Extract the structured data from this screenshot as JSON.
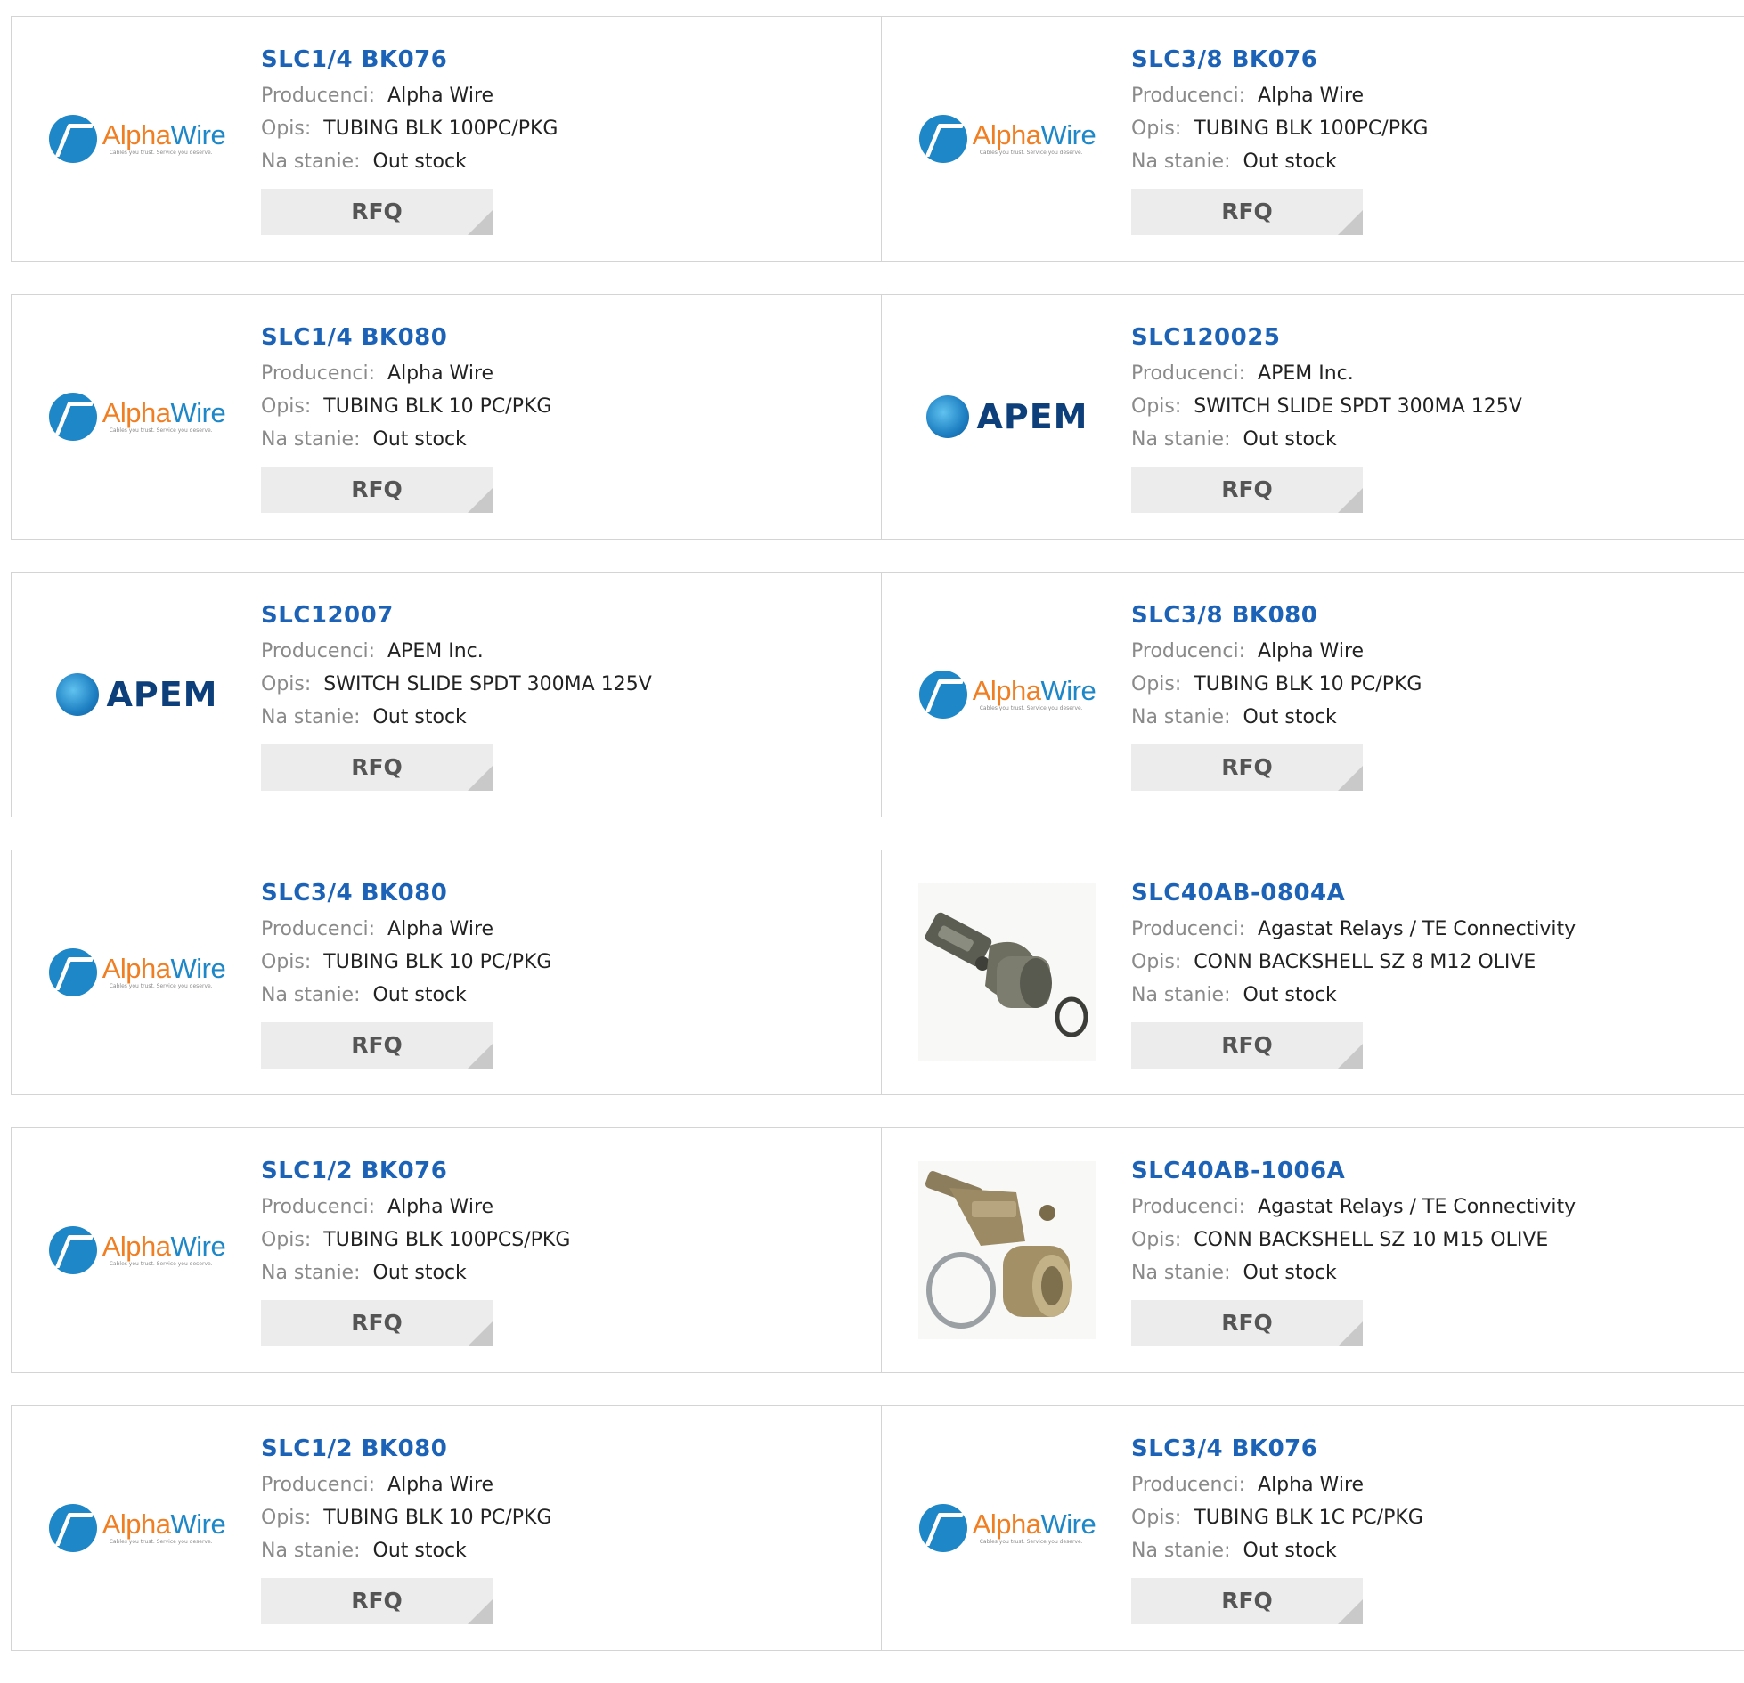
{
  "labels": {
    "manufacturer": "Producenci:",
    "description": "Opis:",
    "stock": "Na stanie:",
    "rfq": "RFQ"
  },
  "logos": {
    "alphawire": {
      "name_part1": "Alpha",
      "name_part2": "Wire",
      "tagline": "Cables you trust. Service you deserve."
    },
    "apem": {
      "word": "APEM"
    }
  },
  "colors": {
    "title": "#1c63b7",
    "label": "#8a8a8a",
    "rfq_bg": "#ececec"
  },
  "products": [
    {
      "title": "SLC1/4 BK076",
      "manufacturer": "Alpha Wire",
      "description": "TUBING BLK 100PC/PKG",
      "stock": "Out stock",
      "image": "alphawire-logo"
    },
    {
      "title": "SLC3/8 BK076",
      "manufacturer": "Alpha Wire",
      "description": "TUBING BLK 100PC/PKG",
      "stock": "Out stock",
      "image": "alphawire-logo"
    },
    {
      "title": "SLC1/4 BK080",
      "manufacturer": "Alpha Wire",
      "description": "TUBING BLK 10 PC/PKG",
      "stock": "Out stock",
      "image": "alphawire-logo"
    },
    {
      "title": "SLC120025",
      "manufacturer": "APEM Inc.",
      "description": "SWITCH SLIDE SPDT 300MA 125V",
      "stock": "Out stock",
      "image": "apem-logo"
    },
    {
      "title": "SLC12007",
      "manufacturer": "APEM Inc.",
      "description": "SWITCH SLIDE SPDT 300MA 125V",
      "stock": "Out stock",
      "image": "apem-logo"
    },
    {
      "title": "SLC3/8 BK080",
      "manufacturer": "Alpha Wire",
      "description": "TUBING BLK 10 PC/PKG",
      "stock": "Out stock",
      "image": "alphawire-logo"
    },
    {
      "title": "SLC3/4 BK080",
      "manufacturer": "Alpha Wire",
      "description": "TUBING BLK 10 PC/PKG",
      "stock": "Out stock",
      "image": "alphawire-logo"
    },
    {
      "title": "SLC40AB-0804A",
      "manufacturer": "Agastat Relays / TE Connectivity",
      "description": "CONN BACKSHELL SZ 8 M12 OLIVE",
      "stock": "Out stock",
      "image": "backshell-photo-1"
    },
    {
      "title": "SLC1/2 BK076",
      "manufacturer": "Alpha Wire",
      "description": "TUBING BLK 100PCS/PKG",
      "stock": "Out stock",
      "image": "alphawire-logo"
    },
    {
      "title": "SLC40AB-1006A",
      "manufacturer": "Agastat Relays / TE Connectivity",
      "description": "CONN BACKSHELL SZ 10 M15 OLIVE",
      "stock": "Out stock",
      "image": "backshell-photo-2"
    },
    {
      "title": "SLC1/2 BK080",
      "manufacturer": "Alpha Wire",
      "description": "TUBING BLK 10 PC/PKG",
      "stock": "Out stock",
      "image": "alphawire-logo"
    },
    {
      "title": "SLC3/4 BK076",
      "manufacturer": "Alpha Wire",
      "description": "TUBING BLK 1C PC/PKG",
      "stock": "Out stock",
      "image": "alphawire-logo"
    }
  ]
}
